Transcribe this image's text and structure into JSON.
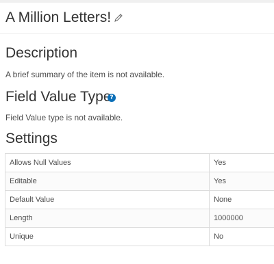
{
  "item": {
    "title": "A Million Letters!",
    "edit_icon": "pencil-icon"
  },
  "description": {
    "heading": "Description",
    "text": "A brief summary of the item is not available."
  },
  "field_value_type": {
    "heading": "Field Value Type",
    "help_icon": "question-circle-icon",
    "help_glyph": "?",
    "text": "Field Value type is not available."
  },
  "settings": {
    "heading": "Settings",
    "rows": [
      {
        "label": "Allows Null Values",
        "value": "Yes"
      },
      {
        "label": "Editable",
        "value": "Yes"
      },
      {
        "label": "Default Value",
        "value": "None"
      },
      {
        "label": "Length",
        "value": "1000000"
      },
      {
        "label": "Unique",
        "value": "No"
      }
    ]
  },
  "colors": {
    "accent": "#0b6fb8",
    "text": "#4c4c4c",
    "heading": "#323232"
  }
}
